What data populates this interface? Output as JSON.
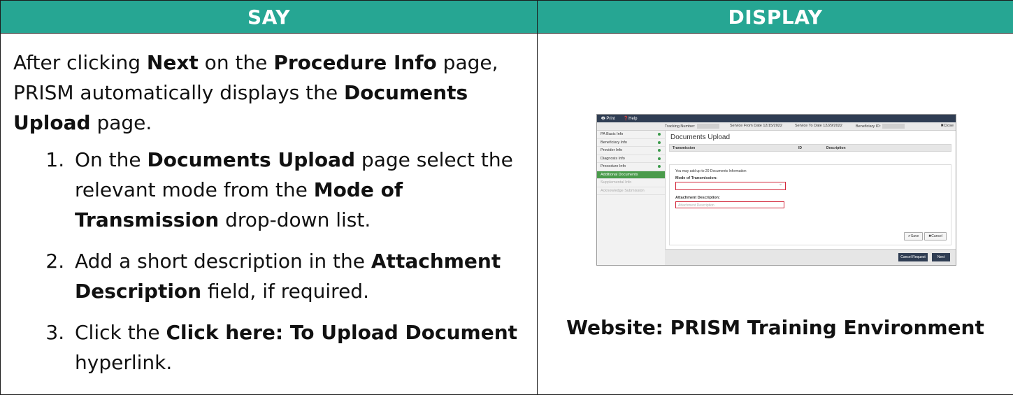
{
  "headers": {
    "say": "SAY",
    "display": "DISPLAY"
  },
  "say": {
    "intro": [
      {
        "t": "After clicking ",
        "b": false
      },
      {
        "t": "Next",
        "b": true
      },
      {
        "t": " on the ",
        "b": false
      },
      {
        "t": "Procedure Info",
        "b": true
      },
      {
        "t": " page, PRISM automatically displays the ",
        "b": false
      },
      {
        "t": "Documents Upload",
        "b": true
      },
      {
        "t": " page.",
        "b": false
      }
    ],
    "steps": [
      [
        {
          "t": "On the ",
          "b": false
        },
        {
          "t": "Documents Upload",
          "b": true
        },
        {
          "t": " page select the relevant mode from the ",
          "b": false
        },
        {
          "t": "Mode of Transmission",
          "b": true
        },
        {
          "t": " drop-down list.",
          "b": false
        }
      ],
      [
        {
          "t": "Add a short description in the ",
          "b": false
        },
        {
          "t": "Attachment Description",
          "b": true
        },
        {
          "t": " field, if required.",
          "b": false
        }
      ],
      [
        {
          "t": "Click the ",
          "b": false
        },
        {
          "t": "Click here: To Upload Document",
          "b": true
        },
        {
          "t": " hyperlink.",
          "b": false
        }
      ]
    ]
  },
  "display": {
    "caption": "Website: PRISM Training Environment",
    "screenshot": {
      "topbar": {
        "print": "Print",
        "help": "Help"
      },
      "trackbar": {
        "tracking": "Tracking Number:",
        "service_from": "Service From Date 12/15/2022",
        "service_to": "Service To Date 12/29/2022",
        "beneficiary": "Beneficiary ID:",
        "close": "✖Close"
      },
      "sidebar": [
        {
          "label": "PA Basic Info",
          "state": "done"
        },
        {
          "label": "Beneficiary Info",
          "state": "done"
        },
        {
          "label": "Provider Info",
          "state": "done"
        },
        {
          "label": "Diagnosis Info",
          "state": "done"
        },
        {
          "label": "Procedure Info",
          "state": "done"
        },
        {
          "label": "Additional Documents",
          "state": "active"
        },
        {
          "label": "Supplemental Info",
          "state": "disabled"
        },
        {
          "label": "Acknowledge Submission",
          "state": "disabled"
        }
      ],
      "title": "Documents Upload",
      "grid_headers": [
        "Transmission",
        "ID",
        "Description"
      ],
      "hint": "You may add up to 20 Documents Information",
      "mode_label": "Mode of Transmission:",
      "attach_label": "Attachment Description:",
      "attach_placeholder": "Attachment Description",
      "save": "✔Save",
      "cancel": "✖Cancel",
      "cancel_request": "Cancel Request",
      "next": "Next"
    }
  }
}
